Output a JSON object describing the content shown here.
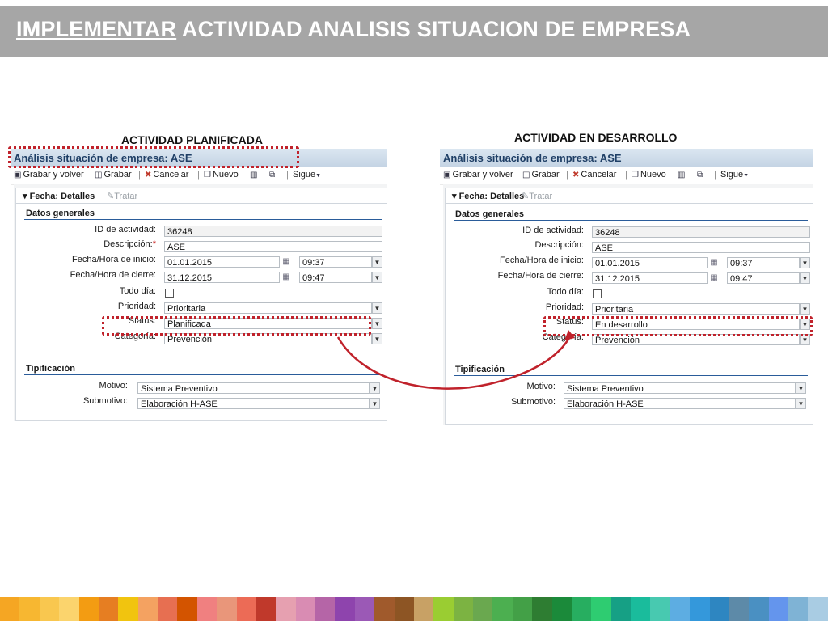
{
  "slide": {
    "title_strong": "IMPLEMENTAR",
    "title_rest": " ACTIVIDAD ANALISIS SITUACION DE EMPRESA"
  },
  "captions": {
    "planned": "ACTIVIDAD PLANIFICADA",
    "in_progress": "ACTIVIDAD EN DESARROLLO"
  },
  "toolbar": {
    "save_back": "Grabar y volver",
    "save": "Grabar",
    "cancel": "Cancelar",
    "new": "Nuevo",
    "more": "Sigue"
  },
  "labels": {
    "tab_details": "Fecha: Detalles",
    "tab_process": "Tratar",
    "section_general": "Datos generales",
    "activity_id": "ID de actividad:",
    "description": "Descripción:",
    "required_mark": "*",
    "start": "Fecha/Hora de inicio:",
    "end": "Fecha/Hora de cierre:",
    "all_day": "Todo día:",
    "priority": "Prioridad:",
    "status": "Status:",
    "category": "Categoría:",
    "section_typification": "Tipificación",
    "reason": "Motivo:",
    "subreason": "Submotivo:"
  },
  "left_panel": {
    "header": "Análisis situación de empresa: ASE",
    "activity_id": "36248",
    "description": "ASE",
    "start_date": "01.01.2015",
    "start_time": "09:37",
    "end_date": "31.12.2015",
    "end_time": "09:47",
    "priority": "Prioritaria",
    "status": "Planificada",
    "category": "Prevención",
    "reason": "Sistema Preventivo",
    "subreason": "Elaboración H-ASE"
  },
  "right_panel": {
    "header": "Análisis situación de empresa: ASE",
    "activity_id": "36248",
    "description": "ASE",
    "start_date": "01.01.2015",
    "start_time": "09:37",
    "end_date": "31.12.2015",
    "end_time": "09:47",
    "priority": "Prioritaria",
    "status": "En desarrollo",
    "category": "Prevención",
    "reason": "Sistema Preventivo",
    "subreason": "Elaboración H-ASE"
  },
  "icons": [
    "save-back-icon",
    "disk-icon",
    "cancel-x-icon",
    "new-doc-icon",
    "trash-icon",
    "copy-icon",
    "chevron-down-icon",
    "pencil-icon",
    "calendar-icon",
    "dropdown-arrow-icon"
  ],
  "colors": {
    "title_bar": "#a6a6a6",
    "highlight": "#c0222b",
    "header_text": "#1f3f66",
    "section_line": "#2a5c9a"
  },
  "footer_stripe_colors": [
    "#f5a623",
    "#f7b731",
    "#f9c74f",
    "#fbd46d",
    "#f39c12",
    "#e67e22",
    "#f1c40f",
    "#f4a261",
    "#e76f51",
    "#d35400",
    "#f08080",
    "#e9967a",
    "#ec6b56",
    "#c0392b",
    "#e6a0b0",
    "#d98cb3",
    "#b565a7",
    "#8e44ad",
    "#9b59b6",
    "#a05a2c",
    "#8d5524",
    "#c8a165",
    "#9acd32",
    "#7cb342",
    "#6aa84f",
    "#4caf50",
    "#43a047",
    "#2e7d32",
    "#1b8a3a",
    "#27ae60",
    "#2ecc71",
    "#16a085",
    "#1abc9c",
    "#48c9b0",
    "#5dade2",
    "#3498db",
    "#2e86c1",
    "#5d8aa8",
    "#4a90c2",
    "#6495ed",
    "#7fb3d5",
    "#a9cce3"
  ]
}
